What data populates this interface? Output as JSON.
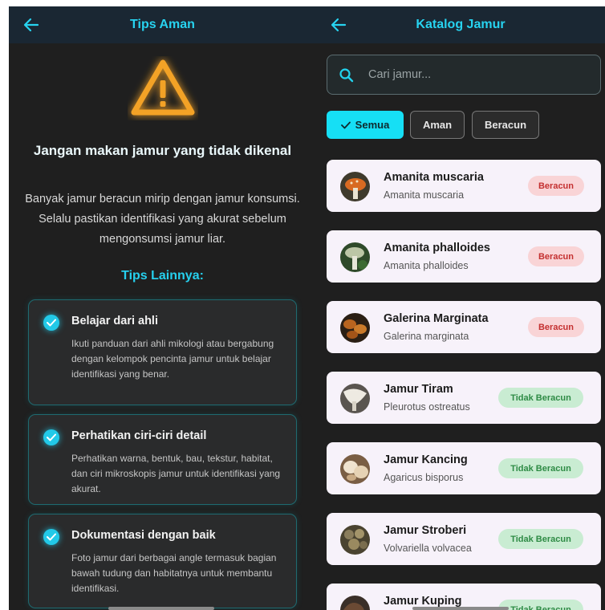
{
  "left": {
    "appbar": {
      "title": "Tips Aman"
    },
    "warning": {
      "title": "Jangan makan jamur yang tidak dikenal",
      "description": "Banyak jamur beracun mirip dengan jamur konsumsi. Selalu pastikan identifikasi yang akurat sebelum mengonsumsi jamur liar."
    },
    "tips_heading": "Tips Lainnya:",
    "tips": [
      {
        "title": "Belajar dari ahli",
        "text": "Ikuti panduan dari ahli mikologi atau bergabung dengan kelompok pencinta jamur untuk belajar identifikasi yang benar."
      },
      {
        "title": "Perhatikan ciri-ciri detail",
        "text": "Perhatikan warna, bentuk, bau, tekstur, habitat, dan ciri mikroskopis jamur untuk identifikasi yang akurat."
      },
      {
        "title": "Dokumentasi dengan baik",
        "text": "Foto jamur dari berbagai angle termasuk bagian bawah tudung dan habitatnya untuk membantu identifikasi."
      }
    ]
  },
  "right": {
    "appbar": {
      "title": "Katalog Jamur"
    },
    "search": {
      "placeholder": "Cari jamur..."
    },
    "filters": [
      {
        "label": "Semua",
        "selected": true
      },
      {
        "label": "Aman",
        "selected": false
      },
      {
        "label": "Beracun",
        "selected": false
      }
    ],
    "items": [
      {
        "name": "Amanita muscaria",
        "latin": "Amanita muscaria",
        "status": "Beracun"
      },
      {
        "name": "Amanita phalloides",
        "latin": "Amanita phalloides",
        "status": "Beracun"
      },
      {
        "name": "Galerina Marginata",
        "latin": "Galerina marginata",
        "status": "Beracun"
      },
      {
        "name": "Jamur Tiram",
        "latin": "Pleurotus ostreatus",
        "status": "Tidak Beracun"
      },
      {
        "name": "Jamur Kancing",
        "latin": "Agaricus bisporus",
        "status": "Tidak Beracun"
      },
      {
        "name": "Jamur Stroberi",
        "latin": "Volvariella volvacea",
        "status": "Tidak Beracun"
      },
      {
        "name": "Jamur Kuping",
        "latin": "",
        "status": "Tidak Beracun"
      }
    ]
  },
  "colors": {
    "accent": "#16dff5",
    "toxic": "#c43030",
    "safe": "#2e8b45",
    "warning": "#f3a227"
  },
  "icons": {
    "back": "arrow-left-icon",
    "warning": "warning-triangle-icon",
    "check": "check-circle-icon",
    "search": "search-icon"
  }
}
